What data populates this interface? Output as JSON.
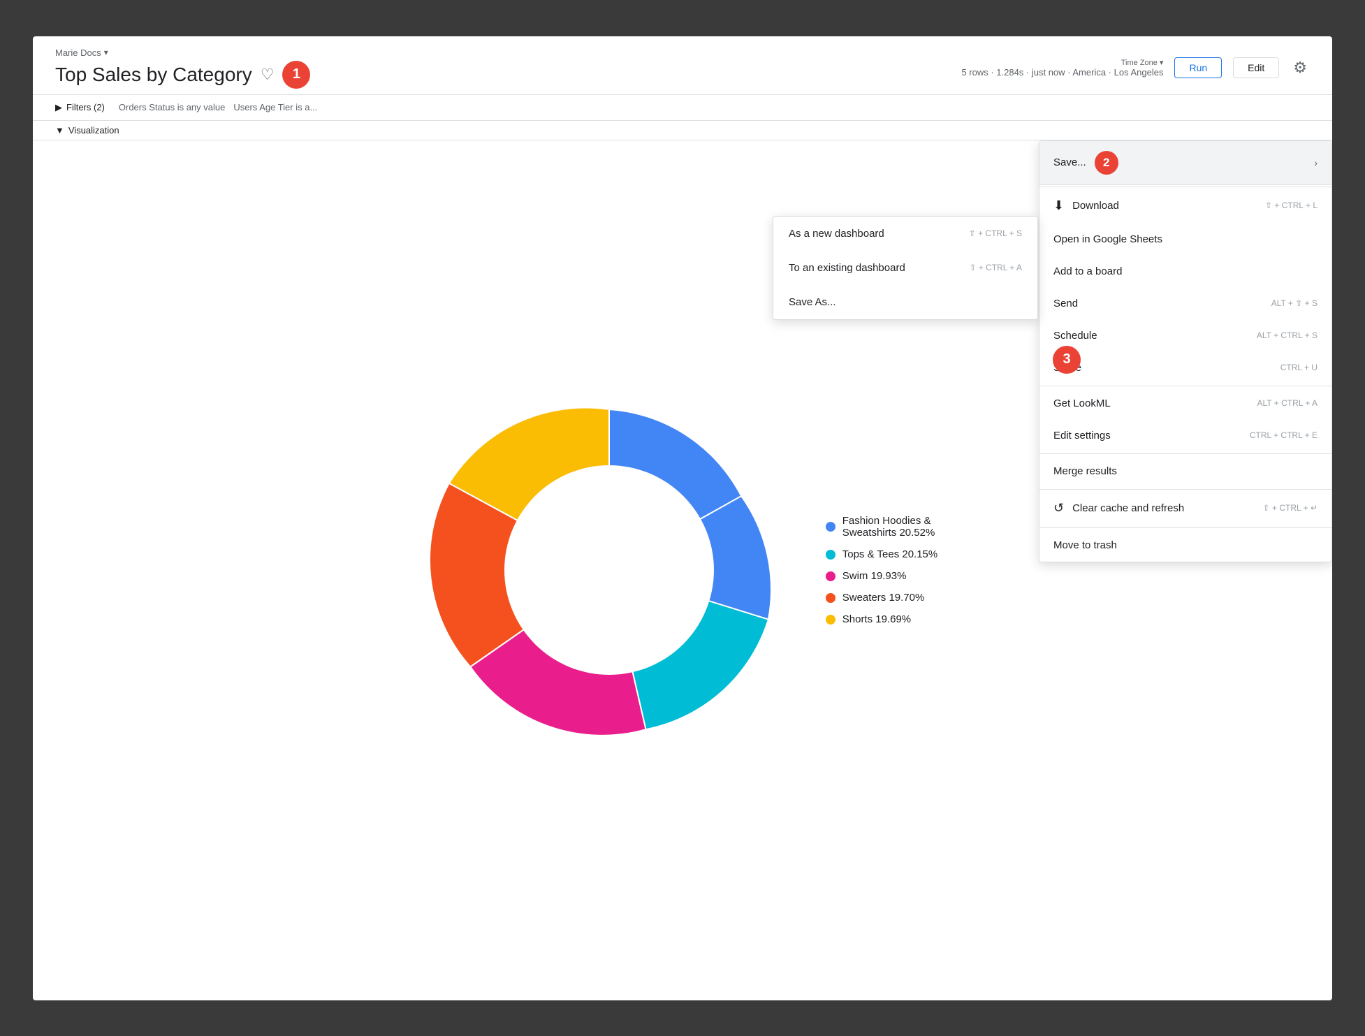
{
  "breadcrumb": {
    "label": "Marie Docs",
    "chevron": "›"
  },
  "header": {
    "title": "Top Sales by Category",
    "heart_label": "♡",
    "badge1": "1",
    "meta": {
      "timezone_label": "Time Zone",
      "timezone_value": "America · Los Angeles",
      "rows": "5 rows · 1.284s · just now · America · Los Angeles"
    },
    "run_label": "Run",
    "edit_label": "Edit",
    "gear_label": "⚙"
  },
  "subheader": {
    "filters_label": "Filters (2)",
    "filter1": "Orders Status is any value",
    "filter2": "Users Age Tier is a..."
  },
  "visualization_label": "Visualization",
  "chart": {
    "segments": [
      {
        "label": "Fashion Hoodies & Sweatshirts",
        "percent": "20.52%",
        "color": "#4285f4",
        "start": 0,
        "extent": 0.2052
      },
      {
        "label": "Tops & Tees",
        "percent": "20.15%",
        "color": "#00bcd4",
        "start": 0.2052,
        "extent": 0.2015
      },
      {
        "label": "Swim",
        "percent": "19.93%",
        "color": "#e91e8c",
        "start": 0.4067,
        "extent": 0.1993
      },
      {
        "label": "Sweaters",
        "percent": "19.70%",
        "color": "#f4511e",
        "start": 0.606,
        "extent": 0.197
      },
      {
        "label": "Shorts",
        "percent": "19.69%",
        "color": "#fbbc04",
        "start": 0.803,
        "extent": 0.1969
      }
    ],
    "legend": [
      {
        "label": "Fashion Hoodies &",
        "label2": "Sweatshirts 20.52%",
        "color": "#4285f4"
      },
      {
        "label": "Tops & Tees 20.15%",
        "label2": "",
        "color": "#00bcd4"
      },
      {
        "label": "Swim 19.93%",
        "label2": "",
        "color": "#e91e8c"
      },
      {
        "label": "Sweaters 19.70%",
        "label2": "",
        "color": "#f4511e"
      },
      {
        "label": "Shorts 19.69%",
        "label2": "",
        "color": "#fbbc04"
      }
    ]
  },
  "main_menu": {
    "save_label": "Save...",
    "badge2": "2",
    "items": [
      {
        "icon": "⬇",
        "label": "Download",
        "shortcut": "⇧ + CTRL + L",
        "has_icon": true
      },
      {
        "label": "Open in Google Sheets",
        "shortcut": "",
        "has_icon": false
      },
      {
        "label": "Add to a board",
        "shortcut": "",
        "has_icon": false
      },
      {
        "label": "Send",
        "shortcut": "ALT + ⇧ + S",
        "has_icon": false
      },
      {
        "label": "Schedule",
        "shortcut": "ALT + CTRL + S",
        "has_icon": false
      },
      {
        "label": "Share",
        "shortcut": "CTRL + U",
        "has_icon": false
      }
    ],
    "section2": [
      {
        "label": "Get LookML",
        "shortcut": "ALT + CTRL + A"
      },
      {
        "label": "Edit settings",
        "shortcut": "CTRL + CTRL + E"
      }
    ],
    "section3": [
      {
        "label": "Merge results",
        "shortcut": ""
      }
    ],
    "section4": [
      {
        "icon": "↺",
        "label": "Clear cache and refresh",
        "shortcut": "⇧ + CTRL + ↵",
        "has_icon": true
      }
    ],
    "section5": [
      {
        "label": "Move to trash",
        "shortcut": ""
      }
    ]
  },
  "submenu": {
    "items": [
      {
        "label": "As a new dashboard",
        "shortcut": "⇧ + CTRL + S"
      },
      {
        "label": "To an existing dashboard",
        "shortcut": "⇧ + CTRL + A"
      },
      {
        "label": "Save As...",
        "shortcut": ""
      }
    ]
  },
  "badge3": "3"
}
